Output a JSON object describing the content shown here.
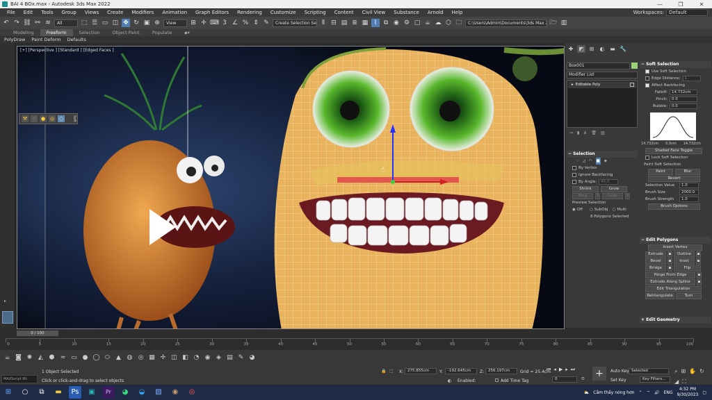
{
  "window": {
    "title": "BAI 4  BOx.max - Autodesk 3ds Max 2022",
    "controls": [
      "—",
      "❐",
      "✕"
    ]
  },
  "menu": {
    "items": [
      "File",
      "Edit",
      "Tools",
      "Group",
      "Views",
      "Create",
      "Modifiers",
      "Animation",
      "Graph Editors",
      "Rendering",
      "Customize",
      "Scripting",
      "Content",
      "Civil View",
      "Substance",
      "Arnold",
      "Help"
    ],
    "workspaces_label": "Workspaces:",
    "workspaces_value": "Default"
  },
  "toolbar": {
    "filter_value": "All",
    "refcoord_value": "View",
    "selection_set_placeholder": "Create Selection Se",
    "project_path": "C:\\Users\\Admin\\Documents\\3ds Max 2022"
  },
  "ribbon": {
    "tabs": [
      "Modeling",
      "Freeform",
      "Selection",
      "Object Paint",
      "Populate"
    ],
    "active_tab": "Freeform",
    "subtabs": [
      "PolyDraw",
      "Paint Deform",
      "Defaults"
    ]
  },
  "viewport": {
    "label": "[+] [Perspective ] [Standard ] [Edged Faces ]",
    "mini_toolbar_label": "Soft",
    "play_icon": "play-icon"
  },
  "command_panel": {
    "object_name": "Box001",
    "object_color": "#9bd37a",
    "modifier_list": "Modifier List",
    "stack_item": "Editable Poly",
    "selection": {
      "title": "Selection",
      "by_vertex": "By Vertex",
      "ignore_backfacing": "Ignore Backfacing",
      "by_angle": "By Angle:",
      "by_angle_value": "45.0",
      "shrink": "Shrink",
      "grow": "Grow",
      "ring": "Ring",
      "loop": "Loop",
      "preview_title": "Preview Selection",
      "preview_off": "Off",
      "preview_subobj": "SubObj",
      "preview_multi": "Multi",
      "status": "8 Polygons Selected"
    },
    "soft_selection": {
      "title": "Soft Selection",
      "use_soft": "Use Soft Selection",
      "edge_distance": "Edge Distance:",
      "edge_distance_value": "1",
      "affect_backfacing": "Affect Backfacing",
      "falloff": "Falloff:",
      "falloff_value": "14.732cm",
      "pinch": "Pinch:",
      "pinch_value": "0.0",
      "bubble": "Bubble:",
      "bubble_value": "0.0",
      "curve_left": "14.732cm",
      "curve_mid": "0.0cm",
      "curve_right": "14.732cm",
      "shaded_face_toggle": "Shaded Face Toggle",
      "lock_soft": "Lock Soft Selection",
      "paint_title": "Paint Soft Selection",
      "paint": "Paint",
      "blur": "Blur",
      "revert": "Revert",
      "selection_value": "Selection Value",
      "selection_value_num": "1.0",
      "brush_size": "Brush Size",
      "brush_size_value": "2000.0",
      "brush_strength": "Brush Strength",
      "brush_strength_value": "1.0",
      "brush_options": "Brush Options"
    },
    "edit_polygons": {
      "title": "Edit Polygons",
      "insert_vertex": "Insert Vertex",
      "extrude": "Extrude",
      "outline": "Outline",
      "bevel": "Bevel",
      "inset": "Inset",
      "bridge": "Bridge",
      "flip": "Flip",
      "hinge": "Hinge From Edge",
      "extrude_spline": "Extrude Along Spline",
      "edit_triangulation": "Edit Triangulation",
      "retriangulate": "Retriangulate",
      "turn": "Turn"
    },
    "edit_geometry": {
      "title": "Edit Geometry"
    }
  },
  "timeline": {
    "slider_label": "0 / 100",
    "ticks": [
      "0",
      "5",
      "10",
      "15",
      "20",
      "25",
      "30",
      "35",
      "40",
      "45",
      "50",
      "55",
      "60",
      "65",
      "70",
      "75",
      "80",
      "85",
      "90",
      "95",
      "100"
    ]
  },
  "status": {
    "maxscript": "MAXScript Mi:",
    "selected": "1 Object Selected",
    "prompt": "Click or click-and-drag to select objects",
    "x_label": "X:",
    "x_value": "275.855cm",
    "y_label": "Y:",
    "y_value": "-192.645cm",
    "z_label": "Z:",
    "z_value": "256.197cm",
    "grid": "Grid = 25.4cm",
    "enabled": "Enabled:",
    "add_time_tag": "Add Time Tag",
    "auto_key": "Auto Key",
    "set_key": "Set Key",
    "selected_dd": "Selected",
    "key_filters": "Key Filters...",
    "frame": "0"
  },
  "taskbar": {
    "weather": "Cầm thấy nóng hơn",
    "lang": "ENG",
    "time": "4:32 PM",
    "date": "9/30/2023"
  }
}
